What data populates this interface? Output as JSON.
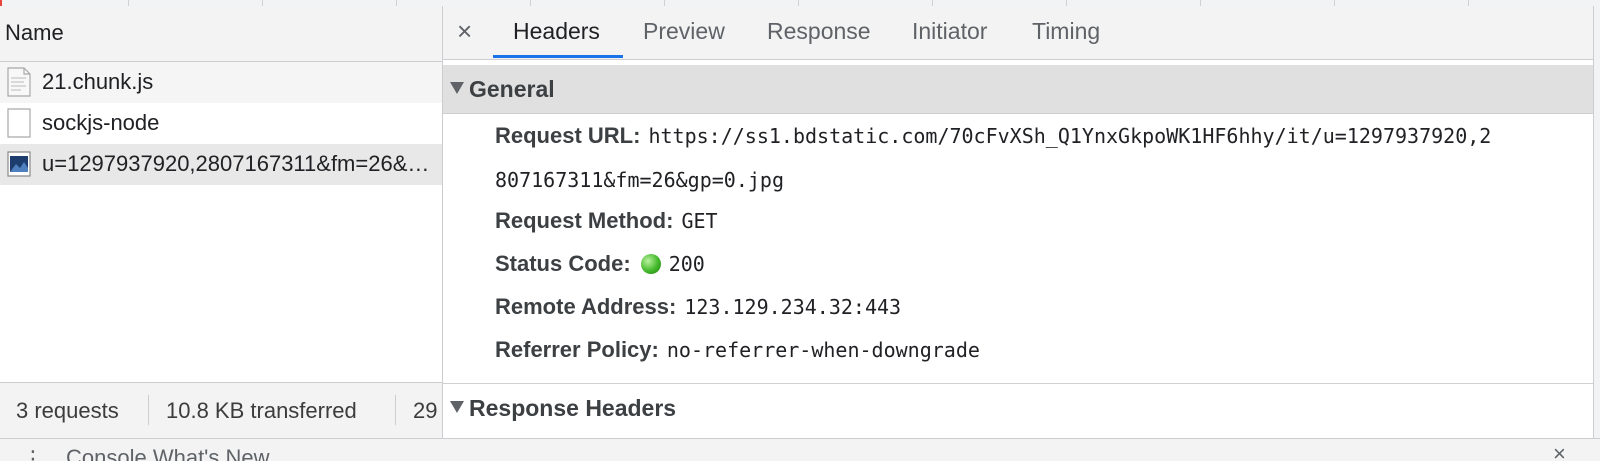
{
  "name_header": "Name",
  "requests": [
    {
      "name": "21.chunk.js",
      "icon": "script-file-icon"
    },
    {
      "name": "sockjs-node",
      "icon": "blank-file-icon"
    },
    {
      "name": "u=1297937920,2807167311&fm=26&gp=0.jpg",
      "icon": "image-file-icon"
    }
  ],
  "status_bar": {
    "requests": "3 requests",
    "transferred": "10.8 KB transferred",
    "resources": "29"
  },
  "tabs": {
    "close": "×",
    "headers": "Headers",
    "preview": "Preview",
    "response": "Response",
    "initiator": "Initiator",
    "timing": "Timing",
    "active": "Headers"
  },
  "general": {
    "title": "General",
    "request_url_label": "Request URL:",
    "request_url_line1": "https://ss1.bdstatic.com/70cFvXSh_Q1YnxGkpoWK1HF6hhy/it/u=1297937920,2",
    "request_url_line2": "807167311&fm=26&gp=0.jpg",
    "request_method_label": "Request Method:",
    "request_method": "GET",
    "status_code_label": "Status Code:",
    "status_code": "200",
    "status_color": "#42b82a",
    "remote_address_label": "Remote Address:",
    "remote_address": "123.129.234.32:443",
    "referrer_policy_label": "Referrer Policy:",
    "referrer_policy": "no-referrer-when-downgrade"
  },
  "response_headers": {
    "title": "Response Headers"
  },
  "drawer": {
    "tab_label": "Console   What's New",
    "close": "×"
  },
  "colors": {
    "accent": "#1a73e8",
    "selected_row": "#e8e8e8"
  }
}
